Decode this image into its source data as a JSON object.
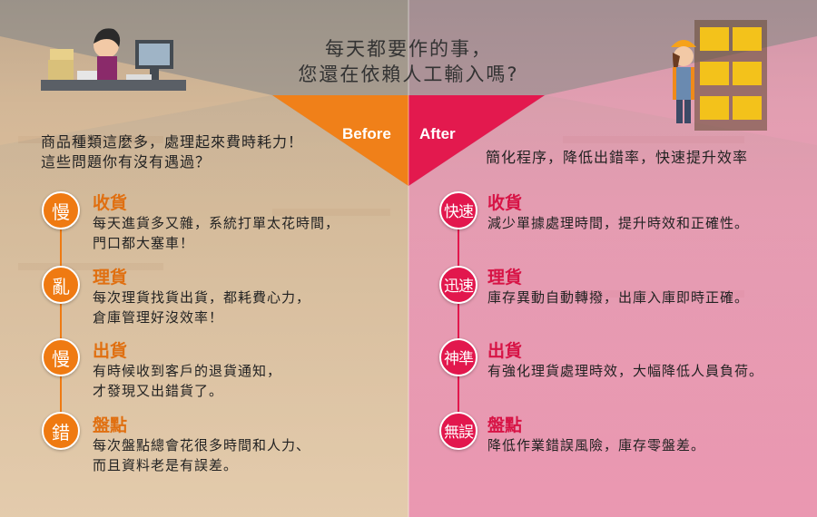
{
  "title": {
    "line1": "每天都要作的事，",
    "line2": "您還在依賴人工輸入嗎?"
  },
  "before": {
    "label": "Before",
    "intro_line1": "商品種類這麼多，處理起來費時耗力！",
    "intro_line2": "這些問題你有沒有遇過？",
    "items": [
      {
        "badge": "慢",
        "heading": "收貨",
        "desc_line1": "每天進貨多又雜，系統打單太花時間，",
        "desc_line2": "門口都大塞車！"
      },
      {
        "badge": "亂",
        "heading": "理貨",
        "desc_line1": "每次理貨找貨出貨，都耗費心力，",
        "desc_line2": "倉庫管理好沒效率！"
      },
      {
        "badge": "慢",
        "heading": "出貨",
        "desc_line1": "有時候收到客戶的退貨通知，",
        "desc_line2": "才發現又出錯貨了。"
      },
      {
        "badge": "錯",
        "heading": "盤點",
        "desc_line1": "每次盤點總會花很多時間和人力、",
        "desc_line2": "而且資料老是有誤差。"
      }
    ]
  },
  "after": {
    "label": "After",
    "intro": "簡化程序，降低出錯率，快速提升效率",
    "items": [
      {
        "badge": "快速",
        "heading": "收貨",
        "desc": "減少單據處理時間，提升時效和正確性。"
      },
      {
        "badge": "迅速",
        "heading": "理貨",
        "desc": "庫存異動自動轉撥，出庫入庫即時正確。"
      },
      {
        "badge": "神準",
        "heading": "出貨",
        "desc": "有強化理貨處理時效，大幅降低人員負荷。"
      },
      {
        "badge": "無誤",
        "heading": "盤點",
        "desc": "降低作業錯誤風險，庫存零盤差。"
      }
    ]
  },
  "colors": {
    "before_accent": "#ef7a12",
    "after_accent": "#e2174d"
  },
  "icons": {
    "left_illustration": "office-worker-desk-illustration",
    "right_illustration": "warehouse-worker-boxes-illustration"
  }
}
